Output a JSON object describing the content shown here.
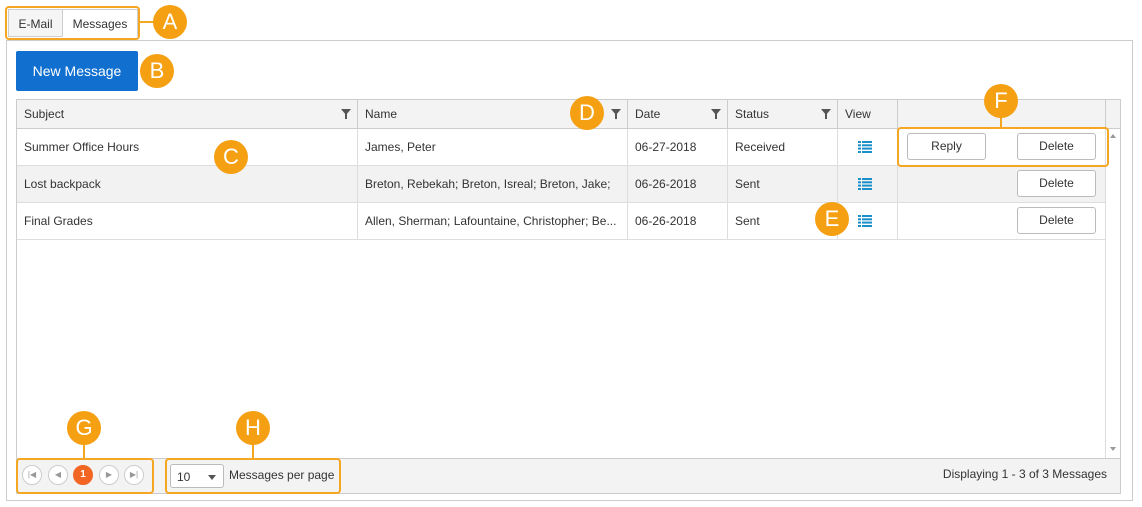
{
  "tabs": [
    {
      "label": "E-Mail"
    },
    {
      "label": "Messages"
    }
  ],
  "new_message_label": "New Message",
  "columns": {
    "subject": "Subject",
    "name": "Name",
    "date": "Date",
    "status": "Status",
    "view": "View"
  },
  "rows": [
    {
      "subject": "Summer Office Hours",
      "name": "James, Peter",
      "date": "06-27-2018",
      "status": "Received",
      "reply": "Reply",
      "delete": "Delete"
    },
    {
      "subject": "Lost backpack",
      "name": "Breton, Rebekah; Breton, Isreal; Breton, Jake;",
      "date": "06-26-2018",
      "status": "Sent",
      "delete": "Delete"
    },
    {
      "subject": "Final Grades",
      "name": "Allen, Sherman; Lafountaine, Christopher; Be...",
      "date": "06-26-2018",
      "status": "Sent",
      "delete": "Delete"
    }
  ],
  "pager": {
    "current_page": "1",
    "page_size": "10",
    "per_page_label": "Messages per page",
    "summary": "Displaying 1 - 3 of 3 Messages"
  },
  "callouts": {
    "a": "A",
    "b": "B",
    "c": "C",
    "d": "D",
    "e": "E",
    "f": "F",
    "g": "G",
    "h": "H"
  },
  "colors": {
    "accent": "#f5a623",
    "primary_button": "#1170cf",
    "current_page": "#f26522",
    "view_icon": "#1a8fc9"
  }
}
